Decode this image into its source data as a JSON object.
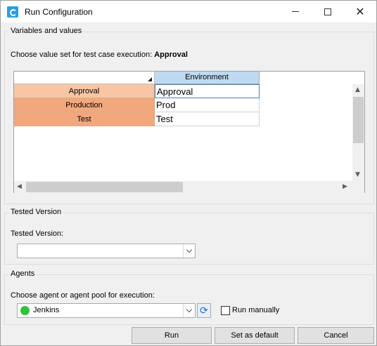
{
  "window": {
    "title": "Run Configuration"
  },
  "variables": {
    "group_title": "Variables and values",
    "prompt_prefix": "Choose value set for test case execution: ",
    "prompt_value": "Approval",
    "grid": {
      "column_header": "Environment",
      "rows": [
        {
          "name": "Approval",
          "value": "Approval"
        },
        {
          "name": "Production",
          "value": "Prod"
        },
        {
          "name": "Test",
          "value": "Test"
        }
      ]
    }
  },
  "tested_version": {
    "group_title": "Tested Version",
    "label": "Tested Version:",
    "selected": ""
  },
  "agents": {
    "group_title": "Agents",
    "label": "Choose agent or agent pool for execution:",
    "selected": "Jenkins",
    "status_color": "#31c23a",
    "run_manually_label": "Run manually",
    "run_manually_checked": false
  },
  "buttons": {
    "run": "Run",
    "set_default": "Set as default",
    "cancel": "Cancel"
  }
}
